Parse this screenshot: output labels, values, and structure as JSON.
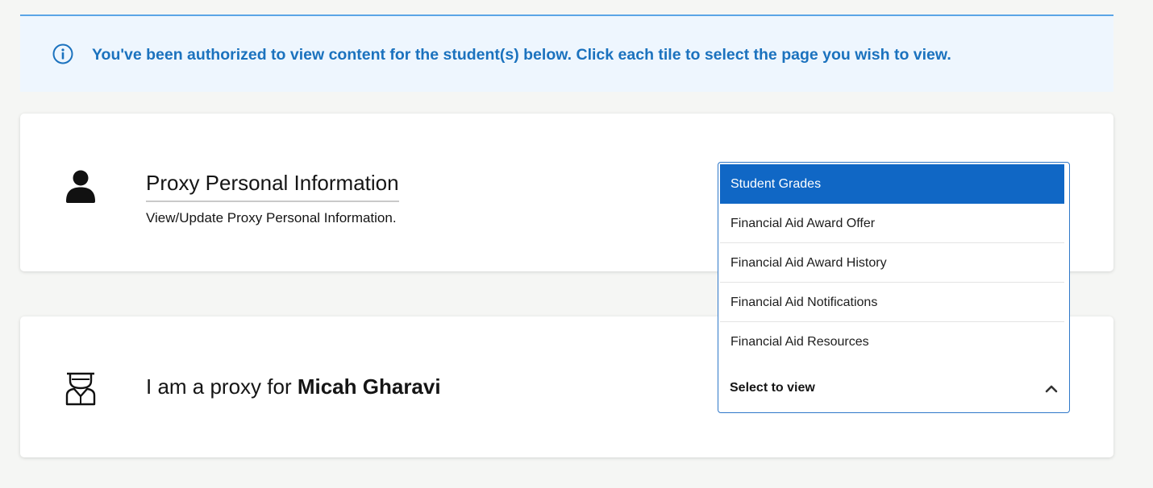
{
  "banner": {
    "text": "You've been authorized to view content for the student(s) below. Click each tile to select the page you wish to view.",
    "icon": "info-icon",
    "color": "#1b72be"
  },
  "card_personal": {
    "title": "Proxy Personal Information",
    "description": "View/Update Proxy Personal Information.",
    "icon": "person-icon"
  },
  "card_proxy": {
    "prefix": "I am a proxy for ",
    "student_name": "Micah Gharavi",
    "icon": "graduate-icon"
  },
  "dropdown": {
    "options": [
      "Student Grades",
      "Financial Aid Award Offer",
      "Financial Aid Award History",
      "Financial Aid Notifications",
      "Financial Aid Resources"
    ],
    "highlighted": "Student Grades",
    "placeholder": "Select to view",
    "accent": "#1067c5"
  }
}
